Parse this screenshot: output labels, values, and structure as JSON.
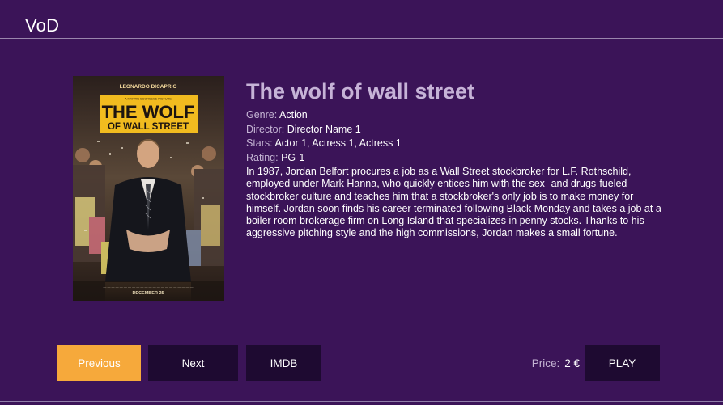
{
  "app": {
    "title": "VoD"
  },
  "movie": {
    "title": "The wolf of wall street",
    "genre_label": "Genre:",
    "genre": "Action",
    "director_label": "Director:",
    "director": "Director Name 1",
    "stars_label": "Stars:",
    "stars": "Actor 1, Actress 1, Actress 1",
    "rating_label": "Rating:",
    "rating": "PG-1",
    "synopsis": "In 1987, Jordan Belfort procures a job as a Wall Street stockbroker for L.F. Rothschild, employed under Mark Hanna, who quickly entices him with the sex- and drugs-fueled stockbroker culture and teaches him that a stockbroker's only job is to make money for himself. Jordan soon finds his career terminated following Black Monday and takes a job at a boiler room brokerage firm on Long Island that specializes in penny stocks. Thanks to his aggressive pitching style and the high commissions, Jordan makes a small fortune."
  },
  "poster": {
    "actor": "LEONARDO DICAPRIO",
    "director_credit": "A MARTIN SCORSESE PICTURE",
    "title_line1": "THE WOLF",
    "title_line2": "OF WALL STREET",
    "release": "DECEMBER 25"
  },
  "controls": {
    "previous_label": "Previous",
    "next_label": "Next",
    "imdb_label": "IMDB",
    "price_label": "Price:",
    "price_value": "2 €",
    "play_label": "PLAY"
  },
  "colors": {
    "background": "#3b1458",
    "accent": "#f6a93b",
    "button": "#1e0a31",
    "title": "#c6b3d7"
  }
}
